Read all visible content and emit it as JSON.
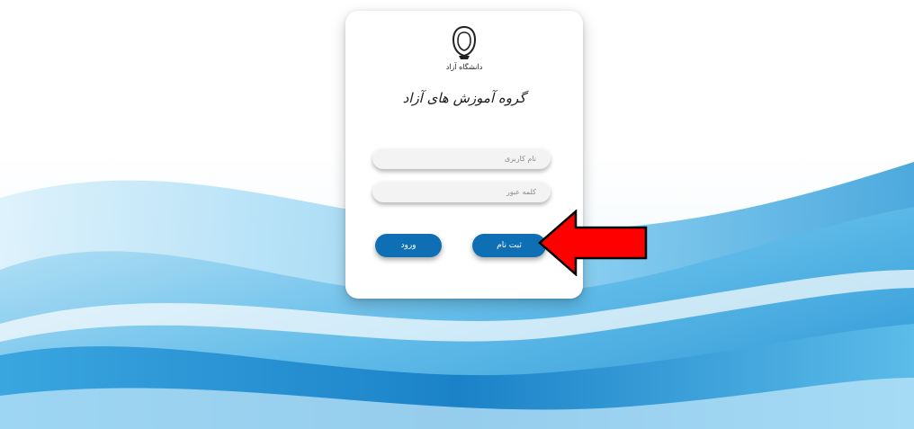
{
  "logo": {
    "caption": "دانشگاه آزاد"
  },
  "card": {
    "title": "گروه آموزش های آزاد"
  },
  "form": {
    "username_placeholder": "نام کاربری",
    "password_placeholder": "کلمه عبور"
  },
  "buttons": {
    "login_label": "ورود",
    "register_label": "ثبت نام"
  },
  "colors": {
    "button_blue": "#0f6fb4",
    "wave_blue": "#38a7e0",
    "arrow_red": "#ff0000"
  }
}
